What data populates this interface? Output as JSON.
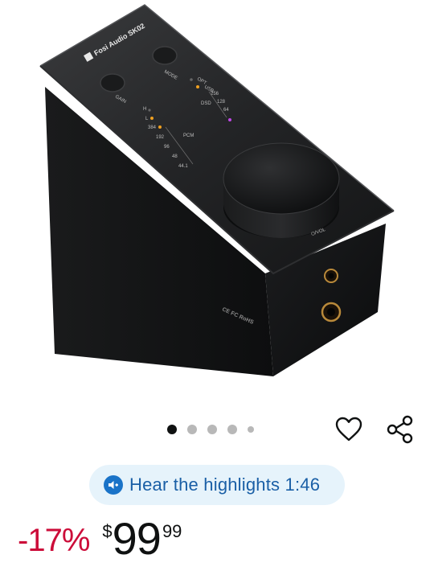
{
  "product": {
    "image_alt": "Fosi Audio SK02 USB DAC headphone amplifier, black, with volume knob",
    "device_labels": {
      "brand": "Fosi Audio SK02",
      "gain": "GAIN",
      "mode": "MODE",
      "opt": "OPT",
      "usb": "USB",
      "dsd_rates": [
        "256",
        "128",
        "64"
      ],
      "dsd": "DSD",
      "hi": "H",
      "lo": "L",
      "pcm": "PCM",
      "pcm_rates": [
        "384",
        "192",
        "96",
        "48",
        "44.1"
      ],
      "vol": "⏻/VOL",
      "ce_marks": "CE FC RoHS"
    }
  },
  "carousel": {
    "total": 5,
    "active": 0
  },
  "actions": {
    "favorite_icon": "heart-icon",
    "share_icon": "share-icon"
  },
  "highlights": {
    "label": "Hear the highlights 1:46",
    "icon": "speaker-icon"
  },
  "pricing": {
    "discount": "-17%",
    "currency": "$",
    "whole": "99",
    "fraction": "99"
  },
  "colors": {
    "discount_red": "#cc0c39",
    "pill_bg": "#e6f3fb",
    "pill_text": "#1a5fa6",
    "dot_active": "#0f1111",
    "dot_inactive": "#b8b8b8"
  }
}
